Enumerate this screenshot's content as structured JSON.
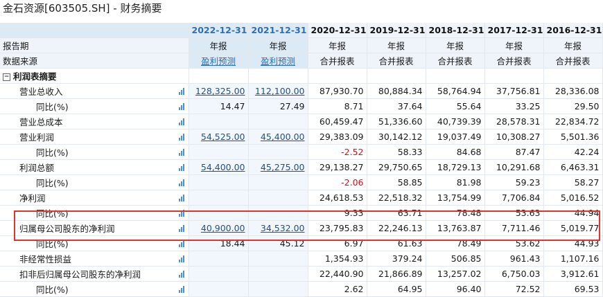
{
  "window": {
    "title": "金石资源[603505.SH] - 财务摘要"
  },
  "columns": [
    "2022-12-31",
    "2021-12-31",
    "2020-12-31",
    "2019-12-31",
    "2018-12-31",
    "2017-12-31",
    "2016-12-31"
  ],
  "report_period": {
    "label": "报告期",
    "values": [
      "年报",
      "年报",
      "年报",
      "年报",
      "年报",
      "年报",
      "年报"
    ]
  },
  "data_source": {
    "label": "数据来源",
    "values": [
      "盈利预测",
      "盈利预测",
      "合并报表",
      "合并报表",
      "合并报表",
      "合并报表",
      "合并报表"
    ]
  },
  "section": {
    "toggle": "−",
    "label": "利润表摘要"
  },
  "rows": [
    {
      "label": "营业总收入",
      "values": [
        "128,325.00",
        "112,100.00",
        "87,930.70",
        "80,884.34",
        "58,764.94",
        "37,756.81",
        "28,336.08"
      ]
    },
    {
      "label": "同比(%)",
      "values": [
        "14.47",
        "27.49",
        "8.71",
        "37.64",
        "55.64",
        "33.25",
        "29.50"
      ]
    },
    {
      "label": "营业总成本",
      "values": [
        "",
        "",
        "60,459.47",
        "51,336.60",
        "40,739.39",
        "28,578.31",
        "22,834.72"
      ]
    },
    {
      "label": "营业利润",
      "values": [
        "54,525.00",
        "45,400.00",
        "29,383.09",
        "30,142.12",
        "19,037.49",
        "10,308.27",
        "5,501.36"
      ]
    },
    {
      "label": "同比(%)",
      "values": [
        "",
        "",
        "-2.52",
        "58.33",
        "84.68",
        "87.47",
        "42.24"
      ]
    },
    {
      "label": "利润总额",
      "values": [
        "54,400.00",
        "45,275.00",
        "29,138.27",
        "29,750.65",
        "18,729.13",
        "10,291.68",
        "6,463.31"
      ]
    },
    {
      "label": "同比(%)",
      "values": [
        "",
        "",
        "-2.06",
        "58.85",
        "81.98",
        "59.23",
        "58.27"
      ]
    },
    {
      "label": "净利润",
      "values": [
        "",
        "",
        "24,618.53",
        "22,518.32",
        "13,754.99",
        "7,706.84",
        "5,016.52"
      ]
    },
    {
      "label": "同比(%)",
      "values": [
        "",
        "",
        "9.33",
        "63.71",
        "78.48",
        "53.63",
        "44.94"
      ]
    },
    {
      "label": "归属母公司股东的净利润",
      "values": [
        "40,900.00",
        "34,532.00",
        "23,795.83",
        "22,246.13",
        "13,763.87",
        "7,711.46",
        "5,019.77"
      ]
    },
    {
      "label": "同比(%)",
      "values": [
        "18.44",
        "45.12",
        "6.97",
        "61.63",
        "78.49",
        "53.62",
        "44.93"
      ]
    },
    {
      "label": "非经常性损益",
      "values": [
        "",
        "",
        "1,354.93",
        "379.24",
        "506.85",
        "961.43",
        "1,107.16"
      ]
    },
    {
      "label": "扣非后归属母公司股东的净利润",
      "values": [
        "",
        "",
        "22,440.90",
        "21,866.89",
        "13,257.02",
        "6,750.03",
        "3,912.61"
      ]
    },
    {
      "label": "同比(%)",
      "values": [
        "",
        "",
        "2.62",
        "64.95",
        "96.40",
        "72.52",
        "69.53"
      ]
    }
  ],
  "colors": {
    "highlight_border": "#e0342c",
    "negative": "#d0121b",
    "forecast_header": "#2e6fb2",
    "chart_icon": "#4a90d9"
  },
  "icons": {
    "row_chart": "bar-chart-icon",
    "collapse": "collapse-toggle-icon"
  }
}
